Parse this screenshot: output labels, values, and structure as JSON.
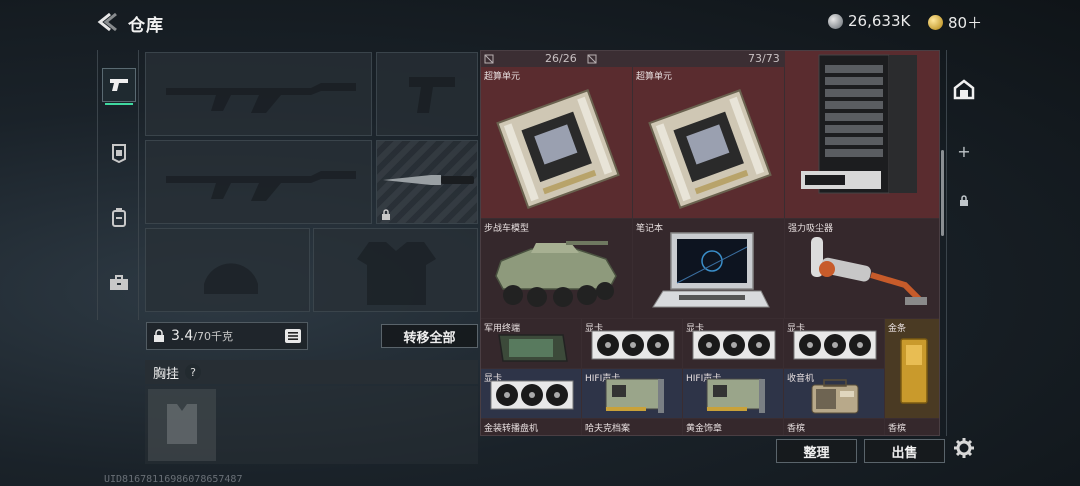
{
  "header": {
    "title": "仓库"
  },
  "currency": {
    "silver": "26,633K",
    "gold": "80＋",
    "add_label": "+"
  },
  "weight": {
    "current": "3.4",
    "max": "/70千克"
  },
  "buttons": {
    "transfer_all": "转移全部",
    "organize": "整理",
    "sell": "出售"
  },
  "vest": {
    "label": "胸挂",
    "help": "?"
  },
  "storage": {
    "counter_left": "26/26",
    "counter_right": "73/73",
    "items": [
      {
        "label": "超算单元",
        "icon": "server-board-icon"
      },
      {
        "label": "超算单元",
        "icon": "server-board-icon"
      },
      {
        "label": "",
        "icon": "server-rack-icon"
      },
      {
        "label": "步战车模型",
        "icon": "armored-vehicle-model-icon"
      },
      {
        "label": "笔记本",
        "icon": "laptop-icon"
      },
      {
        "label": "强力吸尘器",
        "icon": "vacuum-cleaner-icon"
      },
      {
        "label": "军用终端",
        "icon": "military-terminal-icon"
      },
      {
        "label": "显卡",
        "icon": "graphics-card-icon"
      },
      {
        "label": "显卡",
        "icon": "graphics-card-icon"
      },
      {
        "label": "显卡",
        "icon": "graphics-card-icon"
      },
      {
        "label": "金条",
        "icon": "gold-bar-icon"
      },
      {
        "label": "显卡",
        "icon": "graphics-card-icon"
      },
      {
        "label": "HIFI声卡",
        "icon": "sound-card-icon"
      },
      {
        "label": "HIFI声卡",
        "icon": "sound-card-icon"
      },
      {
        "label": "收音机",
        "icon": "radio-icon"
      },
      {
        "label": "金装转播盘机",
        "icon": "item-icon"
      },
      {
        "label": "哈夫克档案",
        "icon": "item-icon"
      },
      {
        "label": "黄金饰章",
        "icon": "item-icon"
      },
      {
        "label": "香槟",
        "icon": "item-icon"
      },
      {
        "label": "香槟",
        "icon": "item-icon"
      }
    ]
  },
  "footer": {
    "uid": "UID816781169860786574​87"
  },
  "colors": {
    "accent": "#3fd9a0",
    "cell_red": "#5a2c2f",
    "cell_blue": "#2e3448"
  }
}
